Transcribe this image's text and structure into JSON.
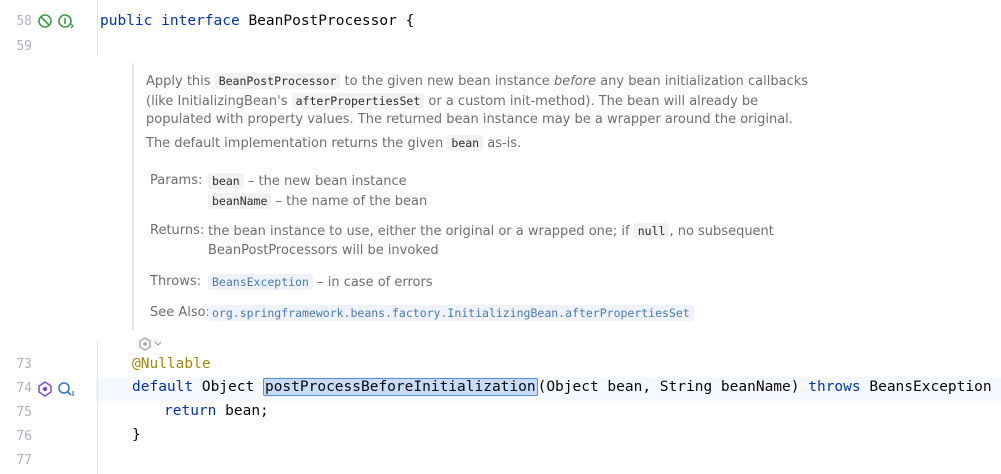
{
  "gutter": {
    "lines": [
      "58",
      "59",
      "73",
      "74",
      "75",
      "76",
      "77"
    ]
  },
  "code": {
    "line58": {
      "kw1": "public",
      "kw2": "interface",
      "name": "BeanPostProcessor",
      "brace": "{"
    },
    "line73": {
      "annotation": "@Nullable"
    },
    "line74": {
      "kw_default": "default",
      "type": "Object",
      "method": "postProcessBeforeInitialization",
      "params": "(Object bean, String beanName)",
      "kw_throws": "throws",
      "exc": "BeansException",
      "brace": "{"
    },
    "line75": {
      "kw_return": "return",
      "rest": "bean;"
    },
    "line76": {
      "brace": "}"
    }
  },
  "doc": {
    "p1_a": "Apply this",
    "p1_chip1": "BeanPostProcessor",
    "p1_b": "to the given new bean instance",
    "p1_before": "before",
    "p1_c": "any bean initialization callbacks",
    "p2_a": "(like InitializingBean's",
    "p2_chip": "afterPropertiesSet",
    "p2_b": "or a custom init-method). The bean will already be",
    "p3": "populated with property values. The returned bean instance may be a wrapper around the original.",
    "p4_a": "The default implementation returns the given",
    "p4_chip": "bean",
    "p4_b": "as-is.",
    "params_label": "Params:",
    "param1_name": "bean",
    "param1_desc": "– the new bean instance",
    "param2_name": "beanName",
    "param2_desc": "– the name of the bean",
    "returns_label": "Returns:",
    "returns_a": "the bean instance to use, either the original or a wrapped one; if",
    "returns_chip": "null",
    "returns_b": ", no subsequent",
    "returns_c": "BeanPostProcessors will be invoked",
    "throws_label": "Throws:",
    "throws_link": "BeansException",
    "throws_desc": "– in case of errors",
    "seealso_label": "See Also:",
    "seealso_link": "org.springframework.beans.factory.InitializingBean.afterPropertiesSet"
  },
  "colors": {
    "keyword": "#0033b3",
    "annotation": "#9e880d",
    "link": "#4a7ab8",
    "selection": "#c6dcf8"
  },
  "icons": [
    "implementations-icon",
    "overrides-info-icon",
    "implemented-method-icon",
    "find-usages-icon",
    "ai-generate-doc-icon"
  ]
}
